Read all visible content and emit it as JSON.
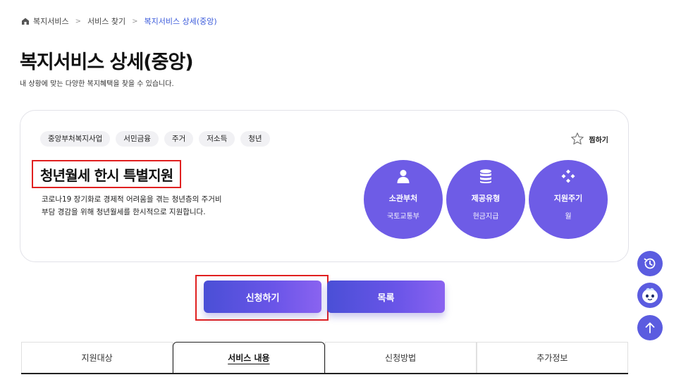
{
  "breadcrumb": {
    "home": "복지서비스",
    "mid": "서비스 찾기",
    "current": "복지서비스 상세(중앙)",
    "separator": ">"
  },
  "header": {
    "title": "복지서비스 상세(중앙)",
    "subtitle": "내 상황에 맞는 다양한 복지혜택을 찾을 수 있습니다."
  },
  "service": {
    "tags": [
      "중앙부처복지사업",
      "서민금융",
      "주거",
      "저소득",
      "청년"
    ],
    "favorite_label": "찜하기",
    "title": "청년월세 한시 특별지원",
    "description_line1": "코로나19 장기화로 경제적 어려움을 겪는 청년층의 주거비",
    "description_line2": "부담 경감을 위해 청년월세를 한시적으로 지원합니다.",
    "info": [
      {
        "label": "소관부처",
        "value": "국토교통부",
        "icon": "person-icon"
      },
      {
        "label": "제공유형",
        "value": "현금지급",
        "icon": "coins-icon"
      },
      {
        "label": "지원주기",
        "value": "월",
        "icon": "diamond-dots-icon"
      }
    ]
  },
  "actions": {
    "apply_label": "신청하기",
    "list_label": "목록"
  },
  "tabs": [
    "지원대상",
    "서비스 내용",
    "신청방법",
    "추가정보"
  ],
  "active_tab": "서비스 내용",
  "colors": {
    "accent": "#6e5ce6",
    "highlight_border": "#e02020",
    "breadcrumb_current": "#3b5bdb"
  }
}
